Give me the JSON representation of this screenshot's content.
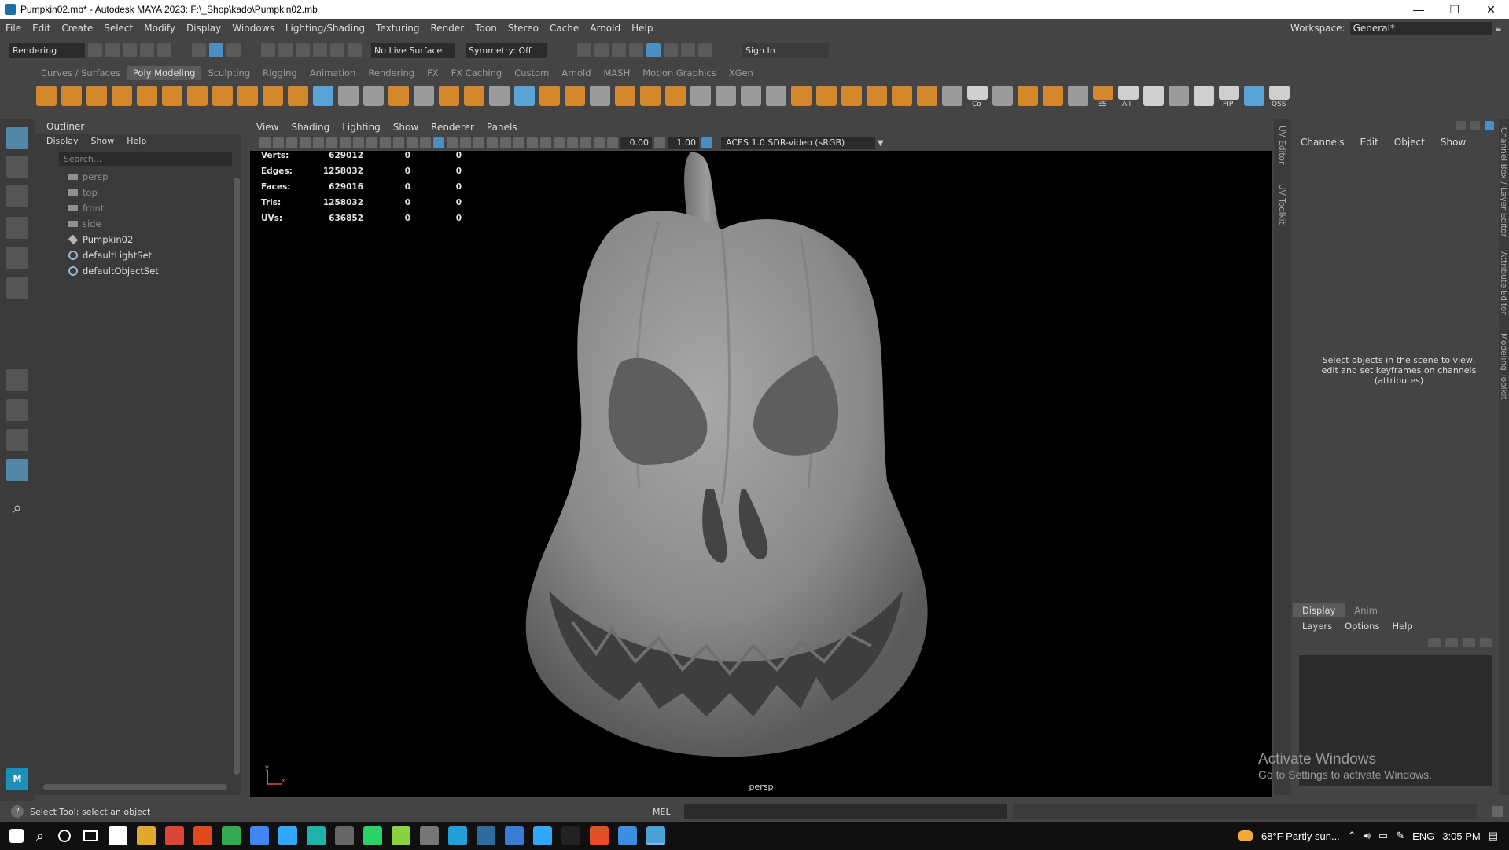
{
  "window": {
    "title": "Pumpkin02.mb* - Autodesk MAYA 2023: F:\\_Shop\\kado\\Pumpkin02.mb",
    "buttons": [
      "—",
      "❐",
      "✕"
    ]
  },
  "menubar": {
    "items": [
      "File",
      "Edit",
      "Create",
      "Select",
      "Modify",
      "Display",
      "Windows",
      "Lighting/Shading",
      "Texturing",
      "Render",
      "Toon",
      "Stereo",
      "Cache",
      "Arnold",
      "Help"
    ],
    "workspace_label": "Workspace:",
    "workspace_value": "General*"
  },
  "statusline": {
    "menuset": "Rendering",
    "live_surface": "No Live Surface",
    "symmetry": "Symmetry: Off",
    "sign_in": "Sign In"
  },
  "shelf": {
    "tabs": [
      "Curves / Surfaces",
      "Poly Modeling",
      "Sculpting",
      "Rigging",
      "Animation",
      "Rendering",
      "FX",
      "FX Caching",
      "Custom",
      "Arnold",
      "MASH",
      "Motion Graphics",
      "XGen"
    ],
    "active_tab": "Poly Modeling",
    "labels": [
      "Co",
      "ES",
      "All",
      "FIP",
      "QSS"
    ]
  },
  "outliner": {
    "title": "Outliner",
    "menu": [
      "Display",
      "Show",
      "Help"
    ],
    "search_placeholder": "Search...",
    "items": [
      {
        "label": "persp",
        "kind": "camera"
      },
      {
        "label": "top",
        "kind": "camera"
      },
      {
        "label": "front",
        "kind": "camera"
      },
      {
        "label": "side",
        "kind": "camera"
      },
      {
        "label": "Pumpkin02",
        "kind": "mesh"
      },
      {
        "label": "defaultLightSet",
        "kind": "set"
      },
      {
        "label": "defaultObjectSet",
        "kind": "set"
      }
    ]
  },
  "viewport": {
    "menu": [
      "View",
      "Shading",
      "Lighting",
      "Show",
      "Renderer",
      "Panels"
    ],
    "exposure": "0.00",
    "gamma": "1.00",
    "colorspace": "ACES 1.0 SDR-video (sRGB)",
    "camera": "persp",
    "hud": [
      {
        "label": "Verts:",
        "v1": "629012",
        "v2": "0",
        "v3": "0"
      },
      {
        "label": "Edges:",
        "v1": "1258032",
        "v2": "0",
        "v3": "0"
      },
      {
        "label": "Faces:",
        "v1": "629016",
        "v2": "0",
        "v3": "0"
      },
      {
        "label": "Tris:",
        "v1": "1258032",
        "v2": "0",
        "v3": "0"
      },
      {
        "label": "UVs:",
        "v1": "636852",
        "v2": "0",
        "v3": "0"
      }
    ],
    "axis_y": "y",
    "axis_x": "x"
  },
  "side_tabs": {
    "left": [
      "UV Editor",
      "UV Toolkit"
    ],
    "right": [
      "Channel Box / Layer Editor",
      "Attribute Editor",
      "Modeling Toolkit"
    ]
  },
  "channelbox": {
    "menu": [
      "Channels",
      "Edit",
      "Object",
      "Show"
    ],
    "message": "Select objects in the scene to view, edit and set keyframes on channels (attributes)"
  },
  "layers": {
    "tabs": [
      "Display",
      "Anim"
    ],
    "active_tab": "Display",
    "menu": [
      "Layers",
      "Options",
      "Help"
    ]
  },
  "watermark": {
    "line1": "Activate Windows",
    "line2": "Go to Settings to activate Windows."
  },
  "helpline": {
    "text": "Select Tool: select an object",
    "mel": "MEL"
  },
  "taskbar": {
    "weather": "68°F  Partly sun...",
    "lang": "ENG",
    "time": "3:05 PM",
    "app_colors": [
      "#ffffff",
      "#e0a92e",
      "#db4437",
      "#e04a1a",
      "#34a853",
      "#4285f4",
      "#31a8ff",
      "#1db3a8",
      "#666666",
      "#25d366",
      "#88d33e",
      "#777777",
      "#229ed9",
      "#2d6ca2",
      "#3a7bd5",
      "#31a8ff",
      "#222222",
      "#e34f26",
      "#3d8de0",
      "#4aa0d8"
    ]
  }
}
